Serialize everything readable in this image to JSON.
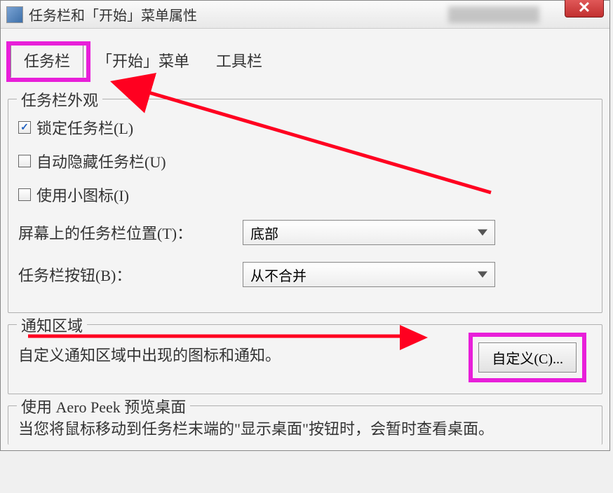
{
  "titlebar": {
    "title": "任务栏和「开始」菜单属性"
  },
  "tabs": [
    {
      "label": "任务栏",
      "active": true
    },
    {
      "label": "「开始」菜单",
      "active": false
    },
    {
      "label": "工具栏",
      "active": false
    }
  ],
  "appearance": {
    "title": "任务栏外观",
    "checkboxes": [
      {
        "label": "锁定任务栏(L)",
        "checked": true
      },
      {
        "label": "自动隐藏任务栏(U)",
        "checked": false
      },
      {
        "label": "使用小图标(I)",
        "checked": false
      }
    ],
    "position": {
      "label": "屏幕上的任务栏位置(T)：",
      "value": "底部"
    },
    "buttons": {
      "label": "任务栏按钮(B)：",
      "value": "从不合并"
    }
  },
  "notify": {
    "title": "通知区域",
    "text": "自定义通知区域中出现的图标和通知。",
    "button": "自定义(C)..."
  },
  "aero": {
    "title": "使用 Aero Peek 预览桌面",
    "text": "当您将鼠标移动到任务栏末端的\"显示桌面\"按钮时，会暂时查看桌面。"
  }
}
